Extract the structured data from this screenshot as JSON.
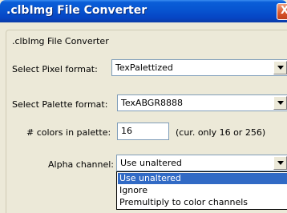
{
  "window": {
    "title": ".clbImg File Converter",
    "close_label": "X"
  },
  "group": {
    "label": ".clbImg File Converter"
  },
  "pixel_format": {
    "label": "Select Pixel format:",
    "value": "TexPalettized"
  },
  "palette_format": {
    "label": "Select Palette format:",
    "value": "TexABGR8888"
  },
  "colors": {
    "label": "# colors in palette:",
    "value": "16",
    "hint": "(cur. only 16 or 256)"
  },
  "alpha": {
    "label": "Alpha channel:",
    "value": "Use unaltered",
    "options": [
      "Use unaltered",
      "Ignore",
      "Premultiply to color channels"
    ],
    "selected_index": 0
  },
  "colors_theme": {
    "titlebar": "#0754d0",
    "selection": "#316ac5",
    "face": "#ece9d8"
  }
}
